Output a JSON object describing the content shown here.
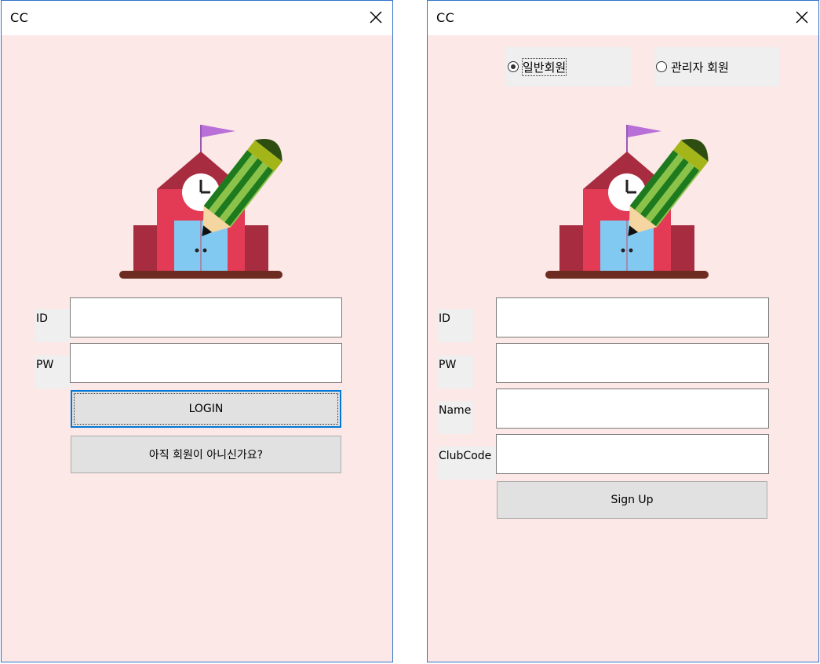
{
  "login_window": {
    "title": "CC",
    "id_label": "ID",
    "pw_label": "PW",
    "id_value": "",
    "pw_value": "",
    "login_button": "LOGIN",
    "signup_link_button": "아직 회원이 아니신가요?"
  },
  "signup_window": {
    "title": "CC",
    "radio_options": [
      {
        "label": "일반회원",
        "checked": true
      },
      {
        "label": "관리자 회원",
        "checked": false
      }
    ],
    "id_label": "ID",
    "pw_label": "PW",
    "name_label": "Name",
    "clubcode_label": "ClubCode",
    "signup_button": "Sign Up"
  },
  "colors": {
    "window_bg": "#fbe8e7",
    "window_border": "#2f73c9",
    "button_bg": "#e1e1e1",
    "focus_blue": "#0078d7"
  },
  "icons": {
    "close": "close-icon",
    "logo": "school-pencil-logo"
  }
}
